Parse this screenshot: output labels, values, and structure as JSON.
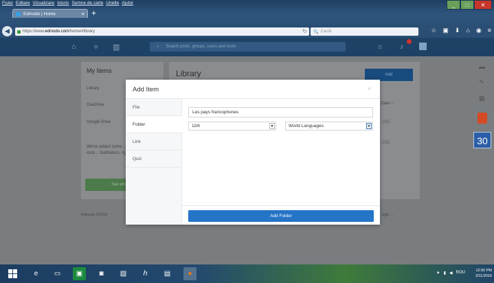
{
  "browser": {
    "menu": [
      "Fișier",
      "Editare",
      "Vizualizare",
      "Istoric",
      "Semne de carte",
      "Unelte",
      "Ajutor"
    ],
    "tab_title": "Edmodo | Home",
    "tab_close": "×",
    "new_tab": "+",
    "url_prefix": "https://www.",
    "url_host": "edmodo.com",
    "url_path": "/home#/library",
    "search_placeholder": "Caută",
    "window_controls": {
      "minimize": "_",
      "maximize": "□",
      "close": "✕"
    }
  },
  "edmodo": {
    "search_placeholder": "Search posts, groups, users and more",
    "left_panel": {
      "title": "My Items",
      "items": [
        "Library",
        "OneDrive",
        "Google Drive"
      ],
      "note": "We've added some ... to the Library, inclu... Subfolders, right-cl... more",
      "button": "See what's ..."
    },
    "library": {
      "title": "Library",
      "add_button": "Add",
      "column": "ed Date ~",
      "rows": [
        "...015",
        "...015"
      ]
    },
    "footer_left": "Edmodo ©2015",
    "footer_right": "ugu ..."
  },
  "modal": {
    "title": "Add Item",
    "close": "×",
    "nav": [
      {
        "label": "File"
      },
      {
        "label": "Folder"
      },
      {
        "label": "Link"
      },
      {
        "label": "Quiz"
      }
    ],
    "active_nav": "Folder",
    "folder_name_value": "Les pays francophones",
    "grade_select": "11th",
    "subject_select": "World Languages",
    "submit": "Add Folder"
  },
  "rail": {
    "calendar_day": "30"
  },
  "taskbar": {
    "tray": "ROU",
    "time": "12:50 PM",
    "date": "3/11/2016"
  },
  "colors": {
    "primary_button": "#2474c7",
    "edmodo_header": "#1e4266",
    "overlay": "#7a7d80"
  }
}
